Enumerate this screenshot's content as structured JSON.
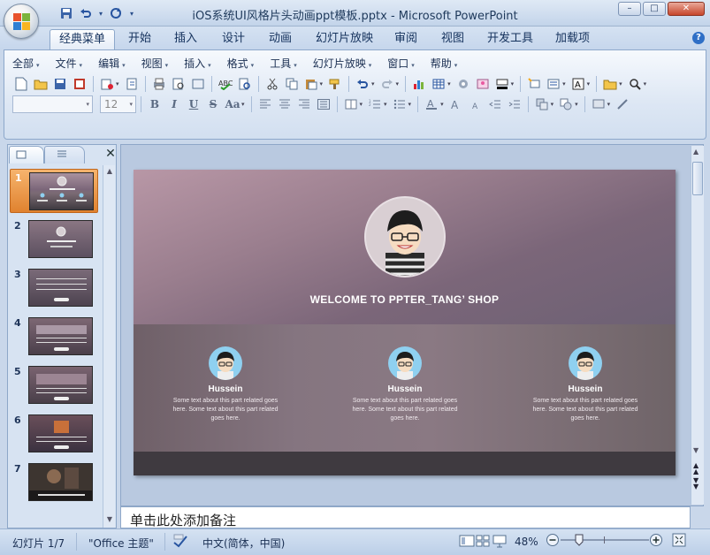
{
  "window": {
    "title": "iOS系统UI风格片头动画ppt模板.pptx - Microsoft PowerPoint",
    "minimize": "–",
    "maximize": "□",
    "close": "✕"
  },
  "qat": {
    "dropdown_glyph": "▾"
  },
  "tabs": [
    {
      "label": "经典菜单",
      "active": true
    },
    {
      "label": "开始"
    },
    {
      "label": "插入"
    },
    {
      "label": "设计"
    },
    {
      "label": "动画"
    },
    {
      "label": "幻灯片放映"
    },
    {
      "label": "审阅"
    },
    {
      "label": "视图"
    },
    {
      "label": "开发工具"
    },
    {
      "label": "加载项"
    }
  ],
  "menu": [
    {
      "label": "全部"
    },
    {
      "label": "文件"
    },
    {
      "label": "编辑"
    },
    {
      "label": "视图"
    },
    {
      "label": "插入"
    },
    {
      "label": "格式"
    },
    {
      "label": "工具"
    },
    {
      "label": "幻灯片放映"
    },
    {
      "label": "窗口"
    },
    {
      "label": "帮助"
    }
  ],
  "font": {
    "name_value": "",
    "size_value": "12",
    "bold": "B",
    "italic": "I",
    "underline": "U",
    "strike": "S",
    "case": "Aa"
  },
  "panes": {
    "close_glyph": "✕"
  },
  "slides": [
    {
      "number": "1",
      "selected": true
    },
    {
      "number": "2"
    },
    {
      "number": "3"
    },
    {
      "number": "4"
    },
    {
      "number": "5"
    },
    {
      "number": "6"
    },
    {
      "number": "7"
    }
  ],
  "slide": {
    "welcome": "WELCOME TO PPTER_TANG’ SHOP",
    "members": [
      {
        "name": "Hussein",
        "desc": "Some text about this part related goes here. Some text about this part related goes here."
      },
      {
        "name": "Hussein",
        "desc": "Some text about this part related goes here. Some text about this part related goes here."
      },
      {
        "name": "Hussein",
        "desc": "Some text about this part related goes here. Some text about this part related goes here."
      }
    ]
  },
  "notes": {
    "placeholder": "单击此处添加备注"
  },
  "status": {
    "slide_counter": "幻灯片 1/7",
    "theme": "\"Office 主题\"",
    "language": "中文(简体，中国)",
    "zoom": "48%",
    "zoom_fraction": 0.48
  },
  "colors": {
    "accent_orange": "#e0822f",
    "ribbon_blue": "#dde7f4",
    "slide_pink": "#b897a6"
  }
}
